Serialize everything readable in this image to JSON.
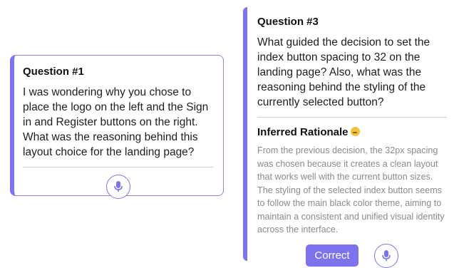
{
  "question1": {
    "title": "Question #1",
    "text": "I was wondering why you chose to place the logo on the left and the Sign in and Register buttons on the right. What was the reasoning behind this layout choice for the landing page?"
  },
  "question3": {
    "title": "Question #3",
    "text": "What guided the decision to set the index button spacing to 32 on the landing page? Also, what was the reasoning behind the styling of the currently selected button?",
    "rationale_title": "Inferred Rationale",
    "rationale_icon": "thinking-face-icon",
    "rationale_text": "From the previous decision, the 32px spacing was chosen because it creates a clean layout that works well with the current button sizes. The styling of the selected index button seems to follow the main black color theme, aiming to maintain a consistent and unified visual identity across the interface.",
    "correct_label": "Correct"
  },
  "colors": {
    "accent": "#7c74ef",
    "muted_text": "#8a8a8f"
  }
}
